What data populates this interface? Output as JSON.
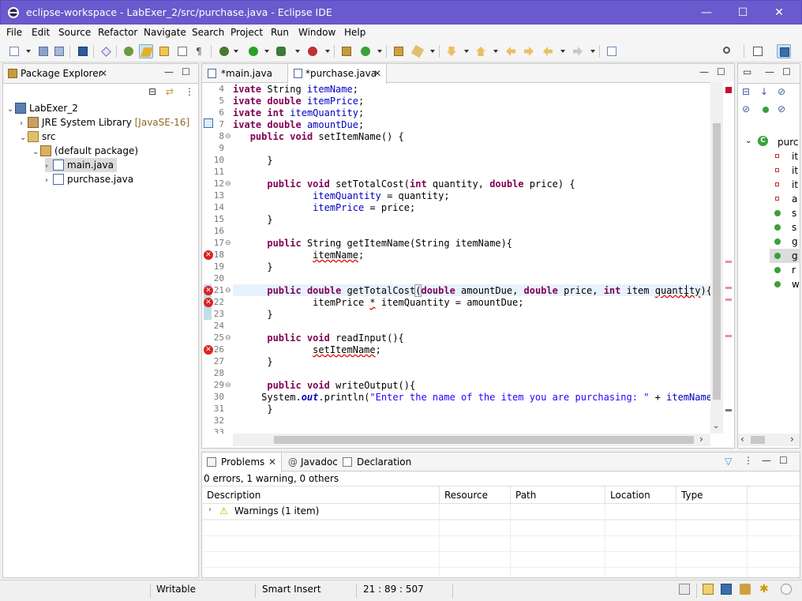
{
  "window": {
    "title": "eclipse-workspace - LabExer_2/src/purchase.java - Eclipse IDE",
    "minimize": "—",
    "maximize": "☐",
    "close": "✕"
  },
  "menu": [
    "File",
    "Edit",
    "Source",
    "Refactor",
    "Navigate",
    "Search",
    "Project",
    "Run",
    "Window",
    "Help"
  ],
  "package_explorer": {
    "title": "Package Explorer",
    "tree": [
      {
        "label": "LabExer_2",
        "suffix": ""
      },
      {
        "label": "JRE System Library",
        "suffix": "[JavaSE-16]"
      },
      {
        "label": "src",
        "suffix": ""
      },
      {
        "label": "(default package)",
        "suffix": ""
      },
      {
        "label": "main.java",
        "suffix": ""
      },
      {
        "label": "purchase.java",
        "suffix": ""
      }
    ]
  },
  "editor": {
    "tabs": [
      "*main.java",
      "*purchase.java"
    ],
    "line_numbers": [
      "4",
      "5",
      "6",
      "7",
      "8",
      "9",
      "10",
      "11",
      "12",
      "13",
      "14",
      "15",
      "16",
      "17",
      "18",
      "19",
      "20",
      "21",
      "22",
      "23",
      "24",
      "25",
      "26",
      "27",
      "28",
      "29",
      "30",
      "31",
      "32",
      "33"
    ],
    "error_marker": "✕"
  },
  "problems": {
    "tabs": [
      "Problems",
      "Javadoc",
      "Declaration"
    ],
    "summary": "0 errors, 1 warning, 0 others",
    "columns": [
      "Description",
      "Resource",
      "Path",
      "Location",
      "Type"
    ],
    "rows": [
      {
        "description": "Warnings (1 item)"
      }
    ]
  },
  "outline": {
    "class_label": "purc",
    "items": [
      "it",
      "it",
      "it",
      "a",
      "s",
      "s",
      "g",
      "g",
      "r",
      "w"
    ]
  },
  "status": {
    "writable": "Writable",
    "insert_mode": "Smart Insert",
    "position": "21 : 89 : 507"
  },
  "colors": {
    "title_bar": "#6a5acd",
    "keyword": "#7f0055",
    "field": "#0000c0",
    "string": "#2a00ff",
    "error": "#dd2222",
    "current_line": "#e8f2fe"
  }
}
